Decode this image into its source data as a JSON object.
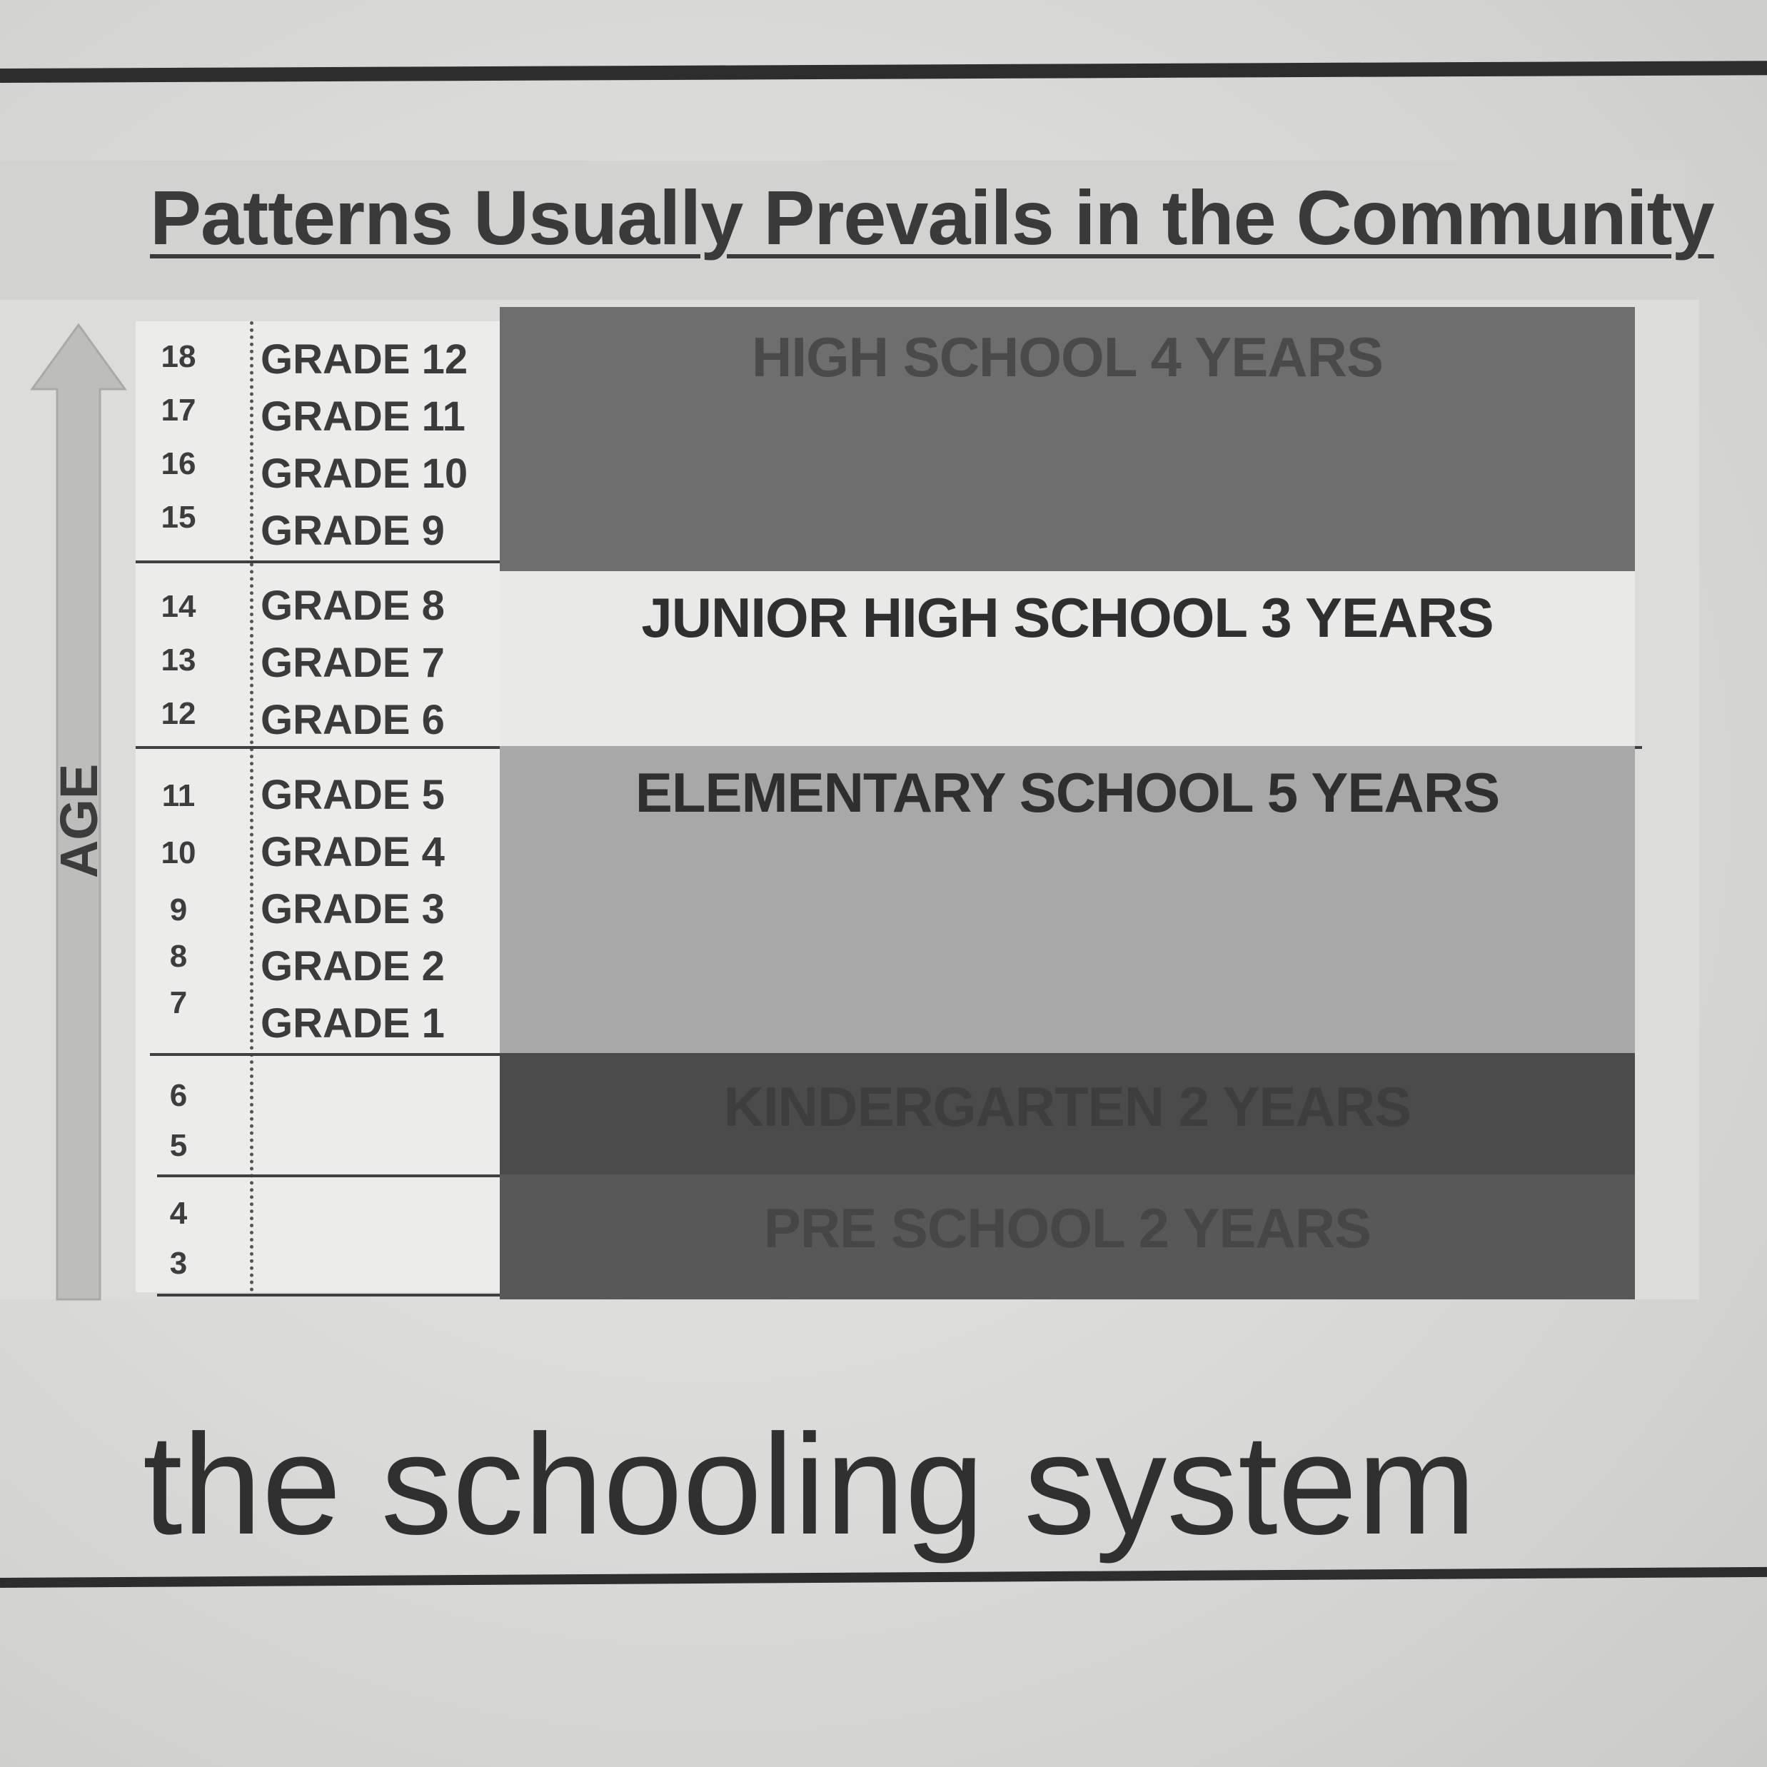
{
  "title": "Patterns Usually Prevails in the Community",
  "axis_label": "AGE",
  "rows": [
    {
      "age": "18",
      "grade": "GRADE 12"
    },
    {
      "age": "17",
      "grade": "GRADE 11"
    },
    {
      "age": "16",
      "grade": "GRADE 10"
    },
    {
      "age": "15",
      "grade": "GRADE 9"
    },
    {
      "age": "14",
      "grade": "GRADE 8"
    },
    {
      "age": "13",
      "grade": "GRADE 7"
    },
    {
      "age": "12",
      "grade": "GRADE 6"
    },
    {
      "age": "11",
      "grade": "GRADE 5"
    },
    {
      "age": "10",
      "grade": "GRADE 4"
    },
    {
      "age": "9",
      "grade": "GRADE 3"
    },
    {
      "age": "8",
      "grade": "GRADE 2"
    },
    {
      "age": "7",
      "grade": "GRADE 1"
    },
    {
      "age": "6",
      "grade": ""
    },
    {
      "age": "5",
      "grade": ""
    },
    {
      "age": "4",
      "grade": ""
    },
    {
      "age": "3",
      "grade": ""
    }
  ],
  "bands": {
    "high_school": "HIGH SCHOOL 4 YEARS",
    "junior_high": "JUNIOR HIGH SCHOOL 3 YEARS",
    "elementary": "ELEMENTARY SCHOOL 5 YEARS",
    "kindergarten": "KINDERGARTEN 2 YEARS",
    "preschool": "PRE SCHOOL 2 YEARS"
  },
  "caption": "the schooling system",
  "colors": {
    "high_school": "#6e6e6e",
    "junior_high": "#e9e9e7",
    "elementary": "#a8a8a8",
    "kindergarten": "#4b4b4b",
    "preschool": "#585858"
  }
}
